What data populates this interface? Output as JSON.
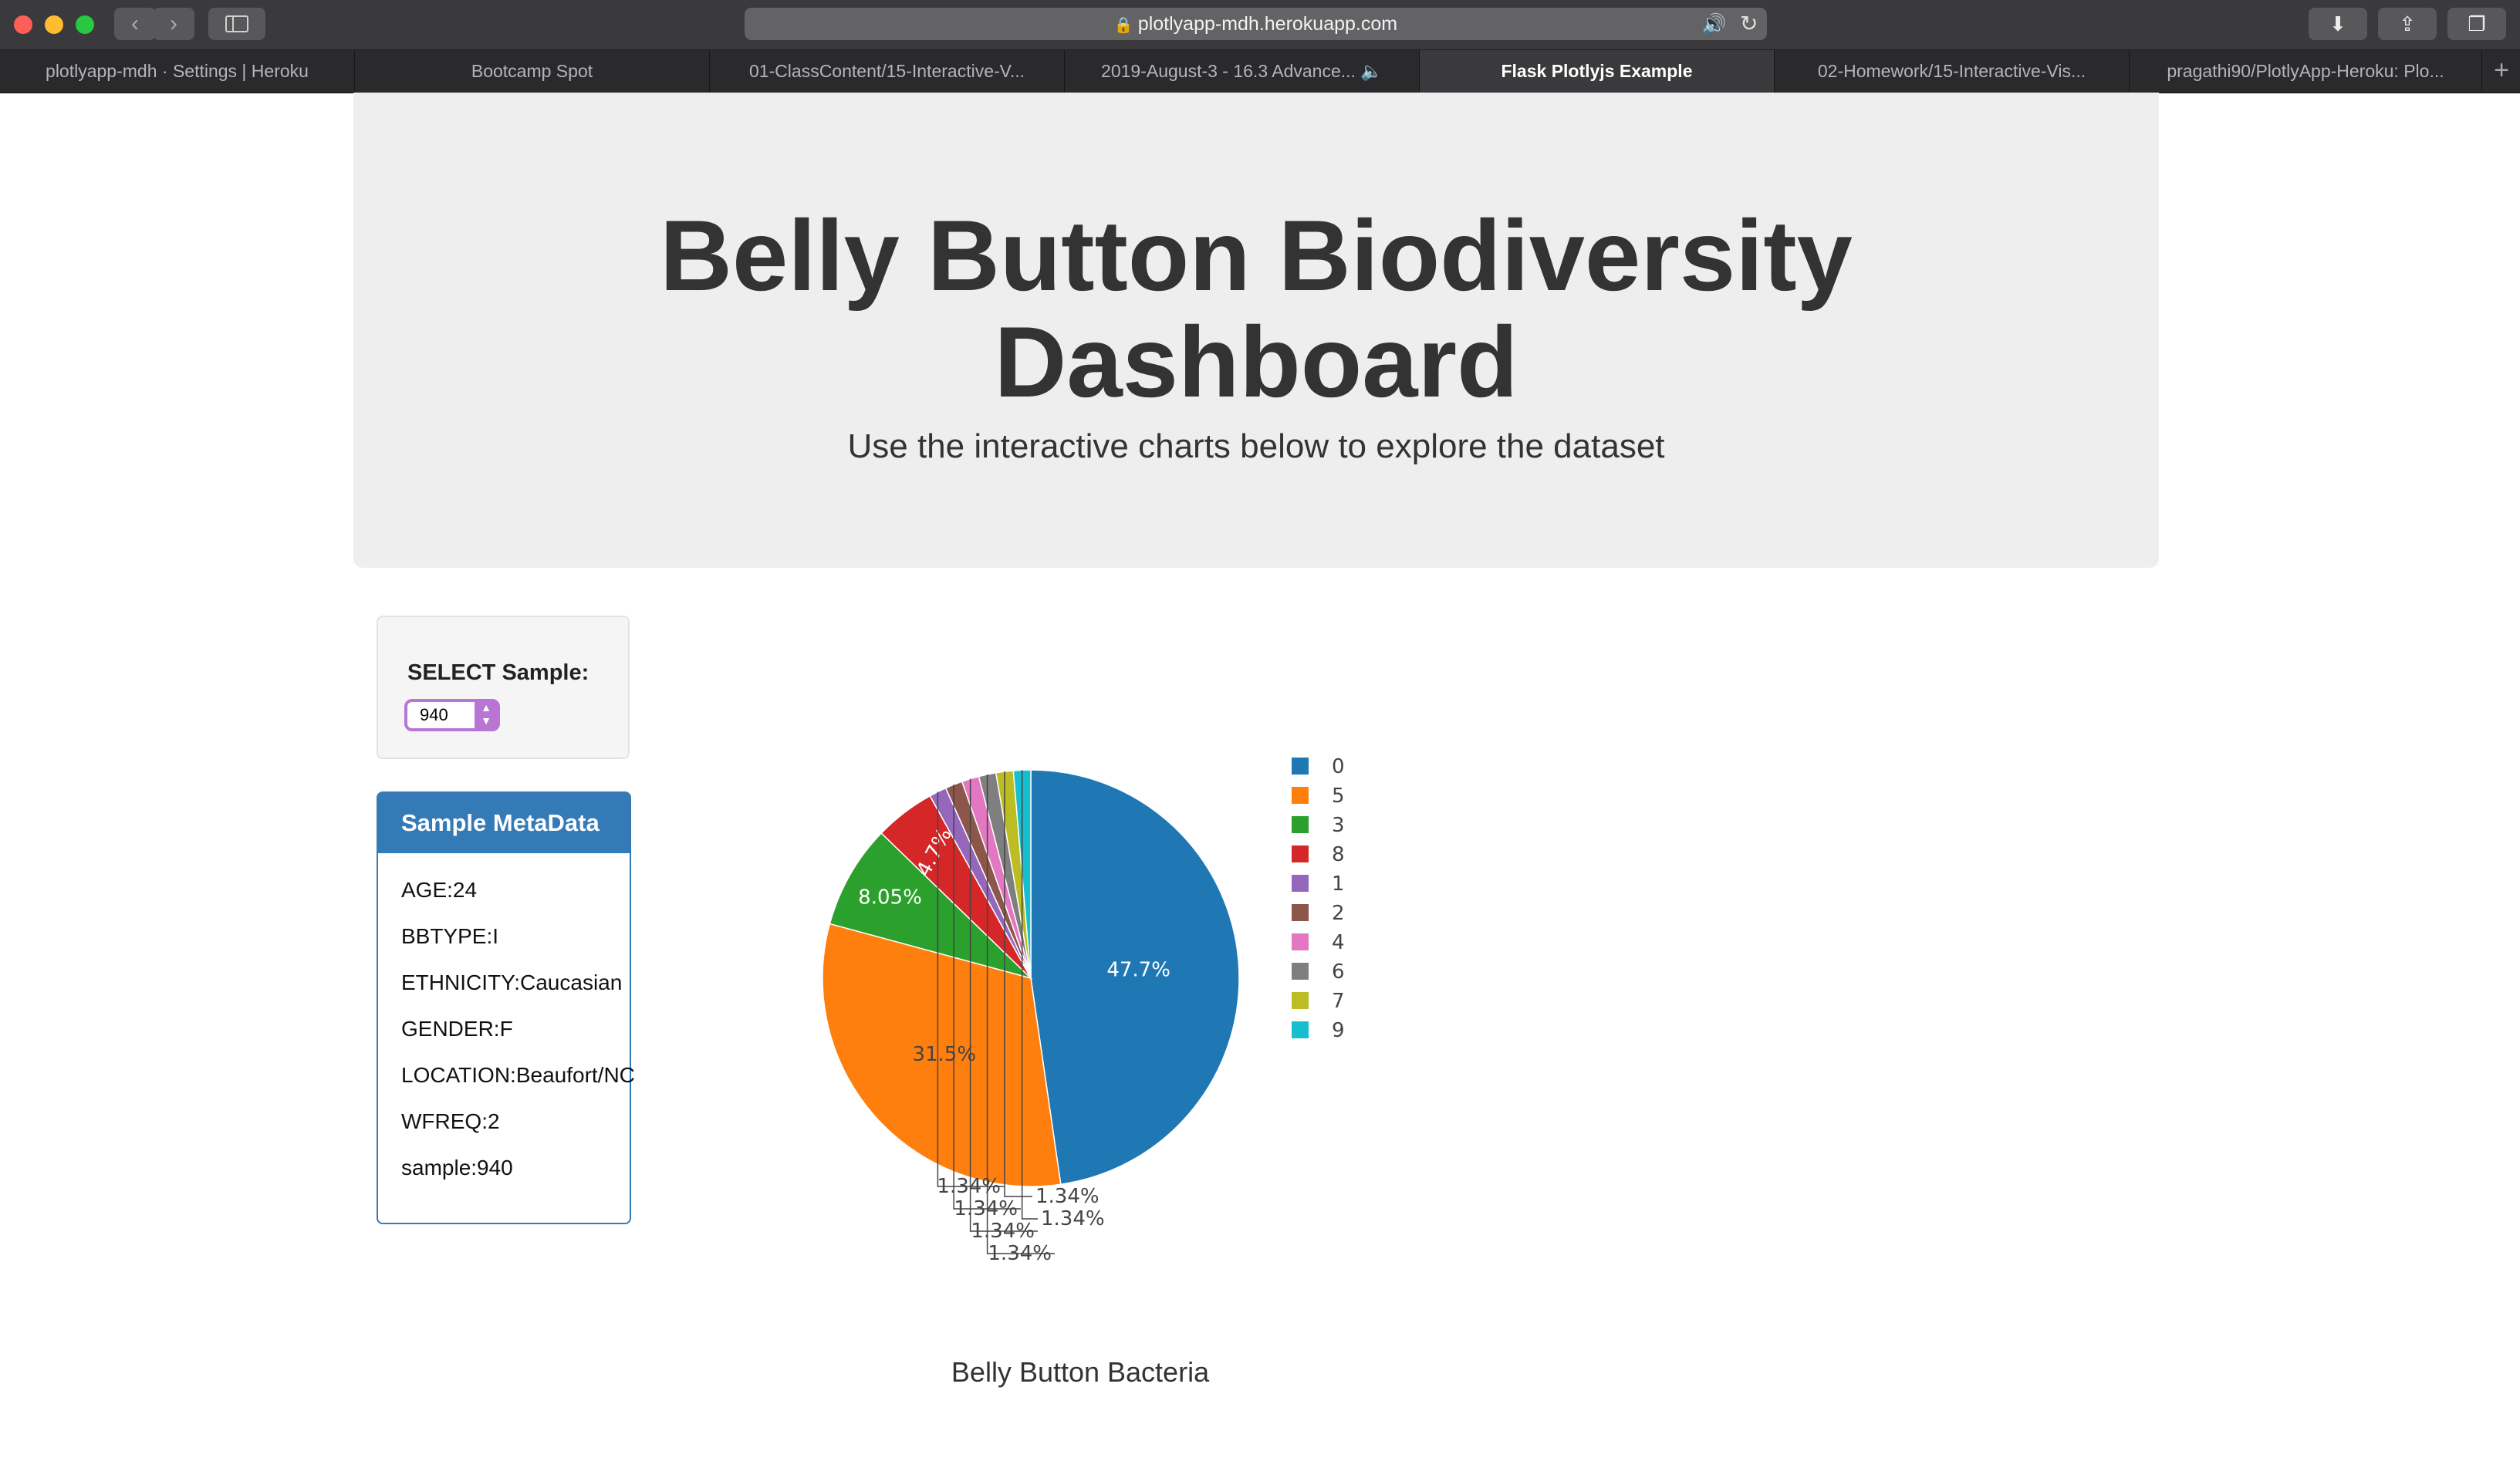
{
  "browser": {
    "url": "plotlyapp-mdh.herokuapp.com",
    "tabs": [
      {
        "title": "plotlyapp-mdh · Settings | Heroku",
        "active": false
      },
      {
        "title": "Bootcamp Spot",
        "active": false
      },
      {
        "title": "01-ClassContent/15-Interactive-V...",
        "active": false
      },
      {
        "title": "2019-August-3 - 16.3 Advance...",
        "active": false
      },
      {
        "title": "Flask Plotlyjs Example",
        "active": true
      },
      {
        "title": "02-Homework/15-Interactive-Vis...",
        "active": false
      },
      {
        "title": "pragathi90/PlotlyApp-Heroku: Plo...",
        "active": false
      }
    ]
  },
  "header": {
    "title_line1": "Belly Button Biodiversity",
    "title_line2": "Dashboard",
    "subtitle": "Use the interactive charts below to explore the dataset"
  },
  "selector": {
    "label": "SELECT Sample:",
    "value": "940"
  },
  "metadata": {
    "heading": "Sample MetaData",
    "items": [
      "AGE:24",
      "BBTYPE:I",
      "ETHNICITY:Caucasian",
      "GENDER:F",
      "LOCATION:Beaufort/NC",
      "WFREQ:2",
      "sample:940"
    ]
  },
  "chart_data": {
    "type": "pie",
    "title": "Belly Button Bacteria",
    "legend_position": "right",
    "labels": [
      "0",
      "5",
      "3",
      "8",
      "1",
      "2",
      "4",
      "6",
      "7",
      "9"
    ],
    "values": [
      47.7,
      31.5,
      8.05,
      4.7,
      1.34,
      1.34,
      1.34,
      1.34,
      1.34,
      1.34
    ],
    "text_labels": [
      "47.7%",
      "31.5%",
      "8.05%",
      "4.7%",
      "1.34%",
      "1.34%",
      "1.34%",
      "1.34%",
      "1.34%",
      "1.34%"
    ],
    "colors": [
      "#1f77b4",
      "#ff7f0e",
      "#2ca02c",
      "#d62728",
      "#9467bd",
      "#8c564b",
      "#e377c2",
      "#7f7f7f",
      "#bcbd22",
      "#17becf"
    ]
  }
}
